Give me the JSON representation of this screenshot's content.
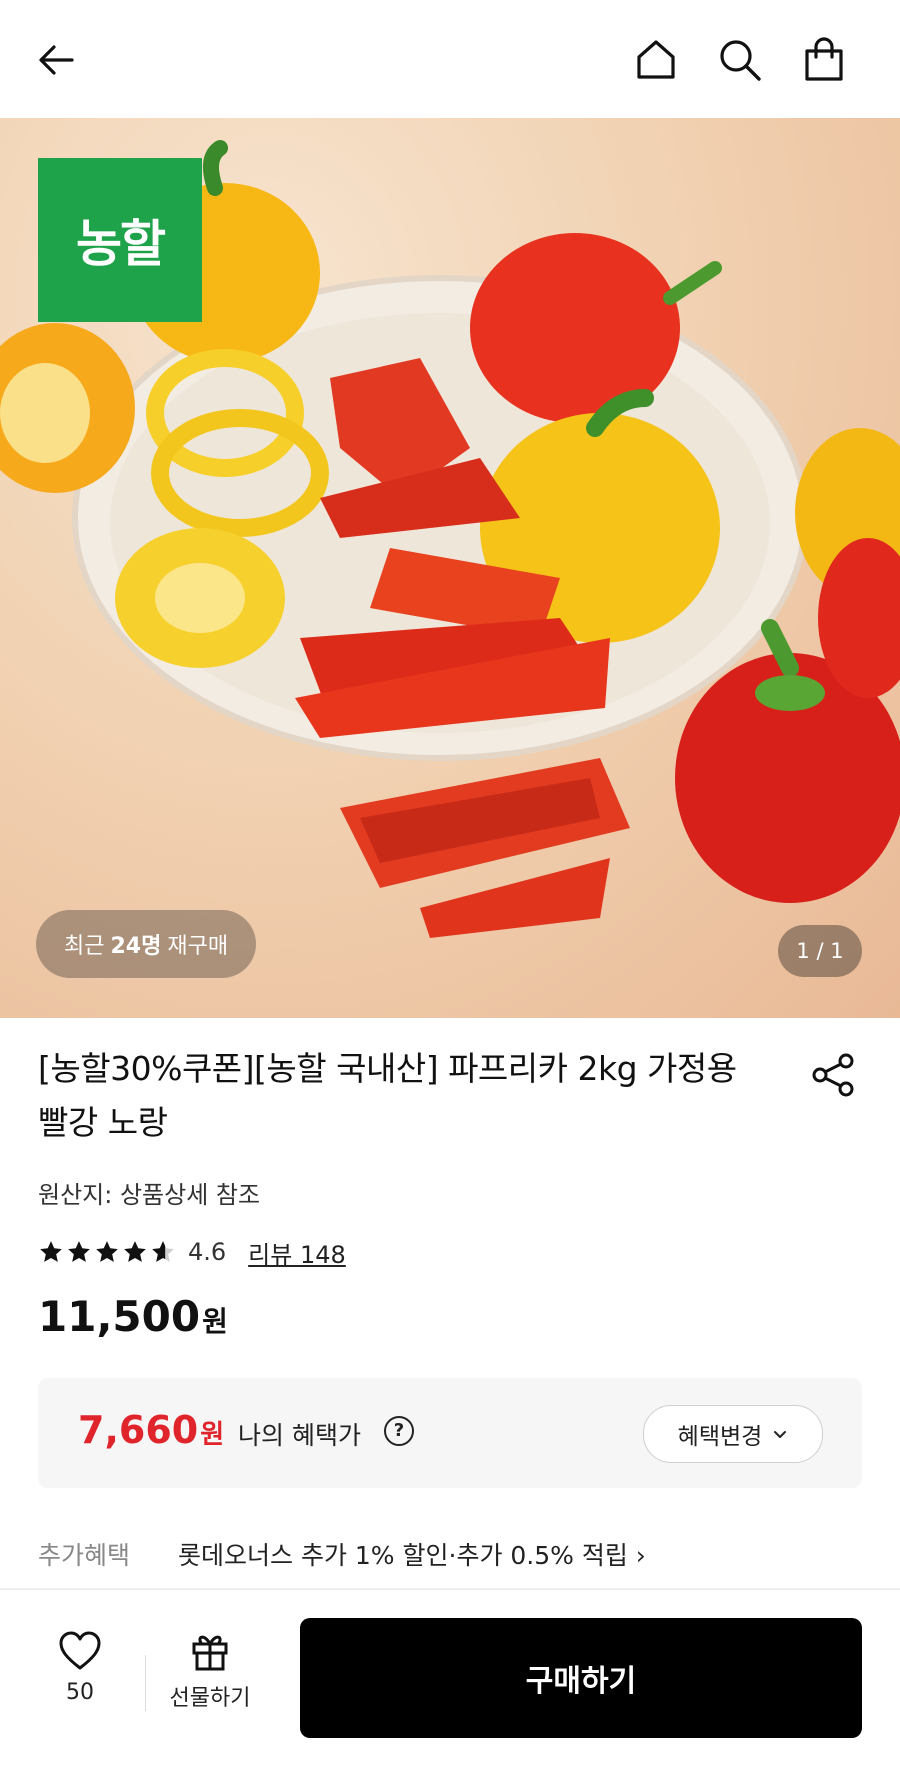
{
  "header": {
    "back_icon": "arrow-left-icon",
    "home_icon": "home-icon",
    "search_icon": "search-icon",
    "cart_icon": "shopping-bag-icon"
  },
  "gallery": {
    "brand_badge": "농할",
    "repurchase_prefix": "최근",
    "repurchase_count": "24명",
    "repurchase_suffix": "재구매",
    "pager": "1 / 1"
  },
  "product": {
    "title": "[농할30%쿠폰][농할 국내산] 파프리카 2kg 가정용 빨강 노랑",
    "origin": "원산지: 상품상세 참조",
    "rating_stars": 4.6,
    "rating_score": "4.6",
    "review_label": "리뷰 148",
    "price": "11,500",
    "price_unit": "원"
  },
  "benefit": {
    "price": "7,660",
    "price_unit": "원",
    "label": "나의 혜택가",
    "change_button": "혜택변경",
    "accent_color": "#e0242c"
  },
  "extra_benefit": {
    "label": "추가혜택",
    "text": "롯데오너스 추가 1% 할인·추가 0.5% 적립 ›"
  },
  "bottom_bar": {
    "like_count": "50",
    "gift_label": "선물하기",
    "buy_label": "구매하기"
  }
}
